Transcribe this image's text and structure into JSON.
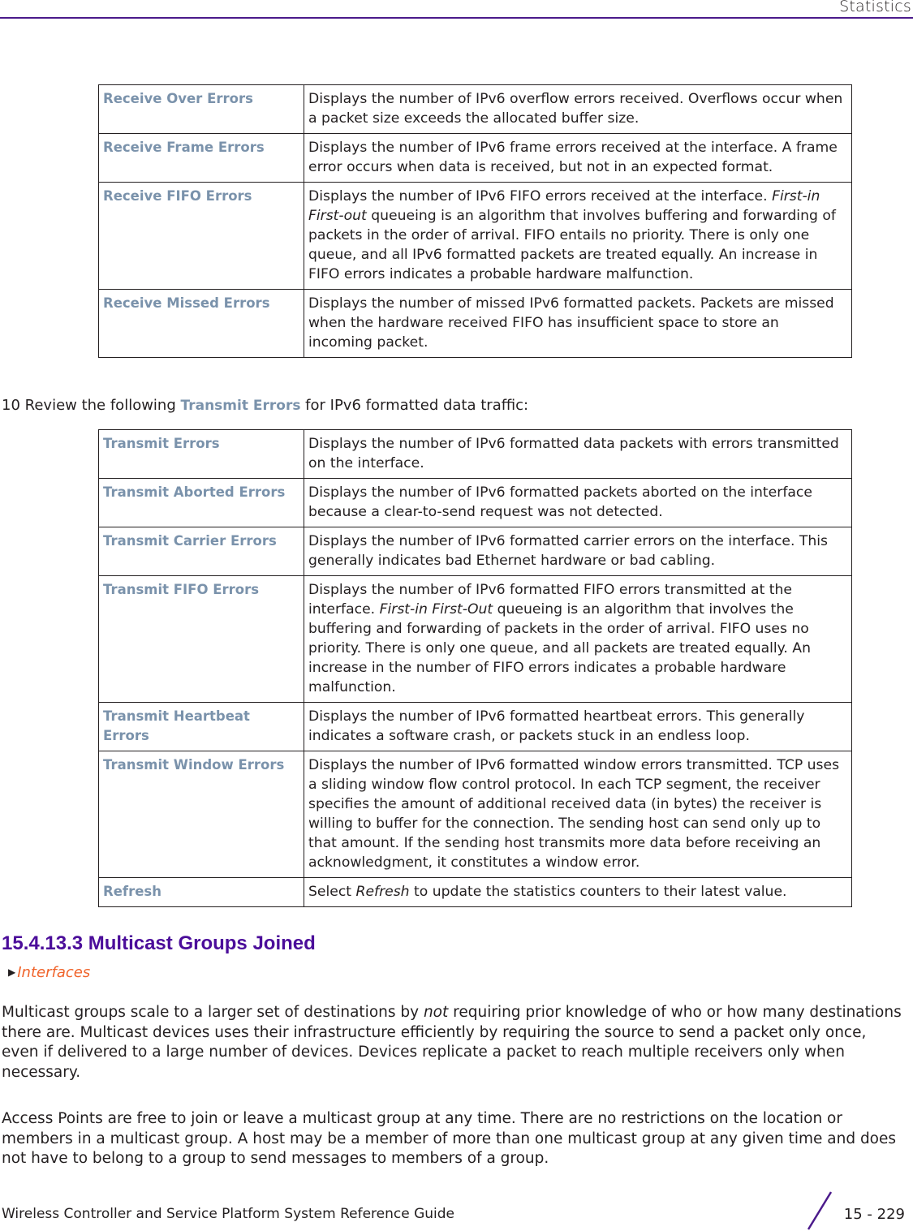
{
  "header": {
    "title": "Statistics"
  },
  "table_receive": {
    "rows": [
      {
        "term": "Receive Over Errors",
        "desc": [
          "Displays the number of IPv6 overflow errors received. Overflows occur when a packet size exceeds the allocated buffer size."
        ]
      },
      {
        "term": "Receive Frame Errors",
        "desc": [
          "Displays the number of IPv6 frame errors received at the interface. A frame error occurs when data is received, but not in an expected format."
        ]
      },
      {
        "term": "Receive FIFO Errors",
        "desc_pre": "Displays the number of IPv6 FIFO errors received at the interface. ",
        "desc_em": "First-in First-out",
        "desc_post": " queueing is an algorithm that involves buffering and forwarding of packets in the order of arrival. FIFO entails no priority. There is only one queue, and all IPv6 formatted packets are treated equally. An increase in FIFO errors indicates a probable hardware malfunction."
      },
      {
        "term": "Receive Missed Errors",
        "desc": [
          "Displays the number of missed IPv6 formatted packets. Packets are missed when the hardware received FIFO has insufficient space to store an incoming packet."
        ]
      }
    ]
  },
  "step": {
    "number": "10",
    "pre": "Review the following ",
    "highlight": "Transmit Errors",
    "post": " for IPv6 formatted data traffic:"
  },
  "table_transmit": {
    "rows": [
      {
        "term": "Transmit Errors",
        "desc": "Displays the number of IPv6 formatted data packets with errors transmitted on the interface."
      },
      {
        "term": "Transmit Aborted Errors",
        "desc": "Displays the number of IPv6 formatted packets aborted on the interface because a clear-to-send request was not detected."
      },
      {
        "term": "Transmit Carrier Errors",
        "desc": "Displays the number of IPv6 formatted carrier errors on the interface. This generally indicates bad Ethernet hardware or bad cabling."
      },
      {
        "term": "Transmit FIFO Errors",
        "desc_pre": "Displays the number of IPv6 formatted FIFO errors transmitted at the interface. ",
        "desc_em": "First-in First-Out",
        "desc_post": " queueing is an algorithm that involves the buffering and forwarding of packets in the order of arrival. FIFO uses no priority. There is only one queue, and all packets are treated equally. An increase in the number of FIFO errors indicates a probable hardware malfunction."
      },
      {
        "term": "Transmit Heartbeat Errors",
        "desc": "Displays the number of IPv6 formatted heartbeat errors. This generally indicates a software crash, or packets stuck in an endless loop."
      },
      {
        "term": "Transmit Window Errors",
        "desc": "Displays the number of IPv6 formatted window errors transmitted. TCP uses a sliding window flow control protocol. In each TCP segment, the receiver specifies the amount of additional received data (in bytes) the receiver is willing to buffer for the connection. The sending host can send only up to that amount. If the sending host transmits more data before receiving an acknowledgment, it constitutes a window error."
      },
      {
        "term": "Refresh",
        "desc_pre": "Select ",
        "desc_em": "Refresh",
        "desc_post": " to update the statistics counters to their latest value."
      }
    ]
  },
  "section": {
    "heading": "15.4.13.3  Multicast Groups Joined",
    "nav_link": "Interfaces",
    "para1_pre": "Multicast groups scale to a larger set of destinations by ",
    "para1_em": "not",
    "para1_post": " requiring prior knowledge of who or how many destinations there are. Multicast devices uses their infrastructure efficiently by requiring the source to send a packet only once, even if delivered to a large number of devices. Devices replicate a packet to reach multiple receivers only when necessary.",
    "para2": "Access Points are free to join or leave a multicast group at any time. There are no restrictions on the location or members in a multicast group. A host may be a member of more than one multicast group at any given time and does not have to belong to a group to send messages to members of a group."
  },
  "footer": {
    "guide_title": "Wireless Controller and Service Platform System Reference Guide",
    "page_number": "15 - 229"
  },
  "colors": {
    "accent_purple": "#4b0d9a",
    "term_blue_gray": "#7a92ab",
    "link_orange": "#f0632a"
  }
}
